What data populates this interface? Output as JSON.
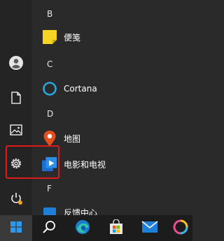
{
  "sections": [
    {
      "letter": "B",
      "apps": [
        {
          "name": "便笺",
          "icon": "sticky-notes-icon"
        }
      ]
    },
    {
      "letter": "C",
      "apps": [
        {
          "name": "Cortana",
          "icon": "cortana-icon"
        }
      ]
    },
    {
      "letter": "D",
      "apps": [
        {
          "name": "地图",
          "icon": "maps-icon"
        }
      ]
    },
    {
      "letter": "",
      "apps": [
        {
          "name": "电影和电视",
          "icon": "movies-tv-icon"
        }
      ]
    },
    {
      "letter": "F",
      "apps": [
        {
          "name": "反馈中心",
          "icon": "feedback-hub-icon"
        }
      ]
    }
  ],
  "rail": [
    "user-icon",
    "document-icon",
    "pictures-icon",
    "settings-icon",
    "power-icon"
  ],
  "taskbar": [
    "windows-start-icon",
    "search-icon",
    "edge-icon",
    "store-icon",
    "mail-icon",
    "photos-icon"
  ],
  "colors": {
    "highlight": "#e01a1a",
    "start_bg": "#3a3a3a",
    "sticky": "#f5d423",
    "cortana": "#29a8e0",
    "maps": "#e2501e",
    "movies": "#1f7fd6"
  }
}
